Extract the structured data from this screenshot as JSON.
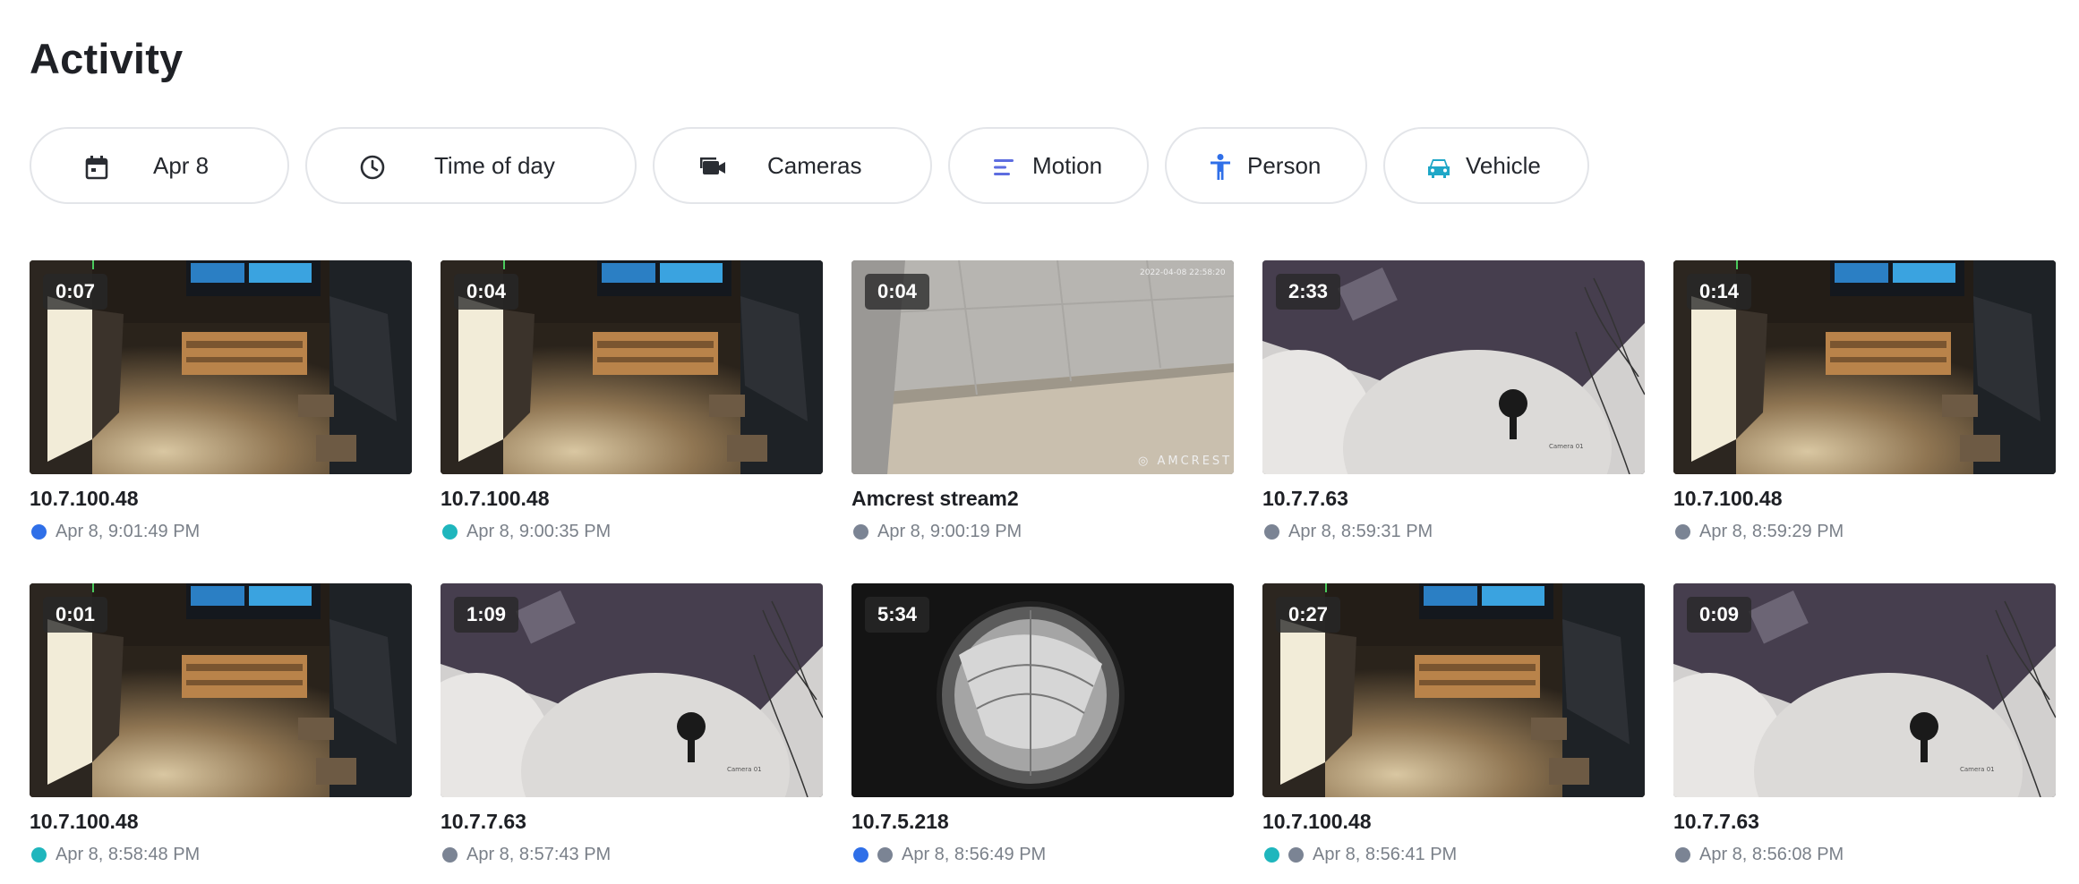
{
  "page_title": "Activity",
  "filters": [
    {
      "name": "date-filter",
      "icon": "calendar-icon",
      "label": "Apr 8"
    },
    {
      "name": "time-of-day-filter",
      "icon": "clock-icon",
      "label": "Time of day"
    },
    {
      "name": "cameras-filter",
      "icon": "video-camera-icon",
      "label": "Cameras"
    },
    {
      "name": "motion-filter",
      "icon": "motion-icon",
      "label": "Motion"
    },
    {
      "name": "person-filter",
      "icon": "person-icon",
      "label": "Person"
    },
    {
      "name": "vehicle-filter",
      "icon": "car-icon",
      "label": "Vehicle"
    }
  ],
  "colors": {
    "person": "#2f6fe8",
    "motion": "#1fb6bd",
    "vehicle": "#1fa7c7",
    "other": "#7b8494"
  },
  "events": [
    {
      "duration": "0:07",
      "camera": "10.7.100.48",
      "time": "Apr 8, 9:01:49 PM",
      "dots": [
        "person"
      ],
      "scene": "room"
    },
    {
      "duration": "0:04",
      "camera": "10.7.100.48",
      "time": "Apr 8, 9:00:35 PM",
      "dots": [
        "motion"
      ],
      "scene": "room"
    },
    {
      "duration": "0:04",
      "camera": "Amcrest stream2",
      "time": "Apr 8, 9:00:19 PM",
      "dots": [
        "other"
      ],
      "scene": "ceiling"
    },
    {
      "duration": "2:33",
      "camera": "10.7.7.63",
      "time": "Apr 8, 8:59:31 PM",
      "dots": [
        "other"
      ],
      "scene": "camera"
    },
    {
      "duration": "0:14",
      "camera": "10.7.100.48",
      "time": "Apr 8, 8:59:29 PM",
      "dots": [
        "other"
      ],
      "scene": "room"
    },
    {
      "duration": "0:01",
      "camera": "10.7.100.48",
      "time": "Apr 8, 8:58:48 PM",
      "dots": [
        "motion"
      ],
      "scene": "room"
    },
    {
      "duration": "1:09",
      "camera": "10.7.7.63",
      "time": "Apr 8, 8:57:43 PM",
      "dots": [
        "other"
      ],
      "scene": "camera"
    },
    {
      "duration": "5:34",
      "camera": "10.7.5.218",
      "time": "Apr 8, 8:56:49 PM",
      "dots": [
        "person",
        "other"
      ],
      "scene": "fisheye"
    },
    {
      "duration": "0:27",
      "camera": "10.7.100.48",
      "time": "Apr 8, 8:56:41 PM",
      "dots": [
        "motion",
        "other"
      ],
      "scene": "room"
    },
    {
      "duration": "0:09",
      "camera": "10.7.7.63",
      "time": "Apr 8, 8:56:08 PM",
      "dots": [
        "other"
      ],
      "scene": "camera"
    }
  ]
}
